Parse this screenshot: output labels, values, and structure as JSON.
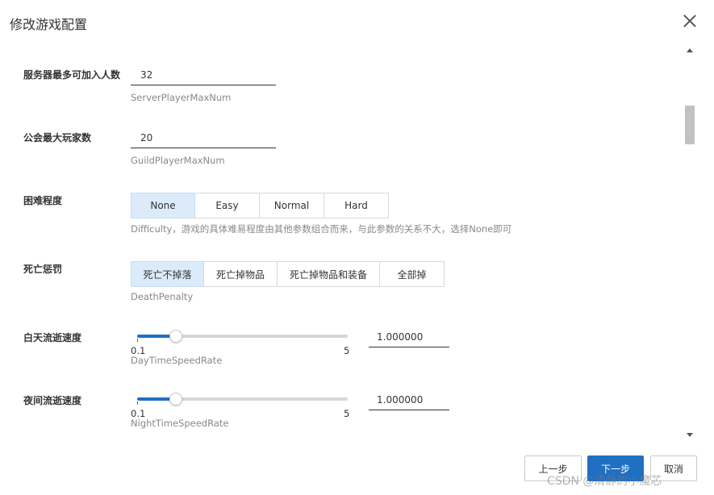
{
  "dialog": {
    "title": "修改游戏配置",
    "close_icon": "close-icon"
  },
  "fields": {
    "server_player_max": {
      "label": "服务器最多可加入人数",
      "value": "32",
      "hint": "ServerPlayerMaxNum"
    },
    "guild_player_max": {
      "label": "公会最大玩家数",
      "value": "20",
      "hint": "GuildPlayerMaxNum"
    },
    "difficulty": {
      "label": "困难程度",
      "options": [
        "None",
        "Easy",
        "Normal",
        "Hard"
      ],
      "selected": "None",
      "hint": "Difficulty，游戏的具体难易程度由其他参数组合而来，与此参数的关系不大，选择None即可"
    },
    "death_penalty": {
      "label": "死亡惩罚",
      "options": [
        "死亡不掉落",
        "死亡掉物品",
        "死亡掉物品和装备",
        "全部掉"
      ],
      "selected": "死亡不掉落",
      "hint": "DeathPenalty"
    },
    "day_time_speed": {
      "label": "白天流逝速度",
      "min": "0.1",
      "max": "5",
      "value": "1.000000",
      "value_num": 1.0,
      "min_num": 0.1,
      "max_num": 5,
      "hint": "DayTimeSpeedRate"
    },
    "night_time_speed": {
      "label": "夜间流逝速度",
      "min": "0.1",
      "max": "5",
      "value": "1.000000",
      "value_num": 1.0,
      "min_num": 0.1,
      "max_num": 5,
      "hint": "NightTimeSpeedRate"
    }
  },
  "footer": {
    "prev_label": "上一步",
    "next_label": "下一步",
    "cancel_label": "取消"
  },
  "watermark": "CSDN @清静的小魔芯",
  "colors": {
    "primary": "#1f6fc2",
    "selected_bg": "#dcebfa",
    "border": "#d9d9d9",
    "hint_text": "#888888"
  }
}
